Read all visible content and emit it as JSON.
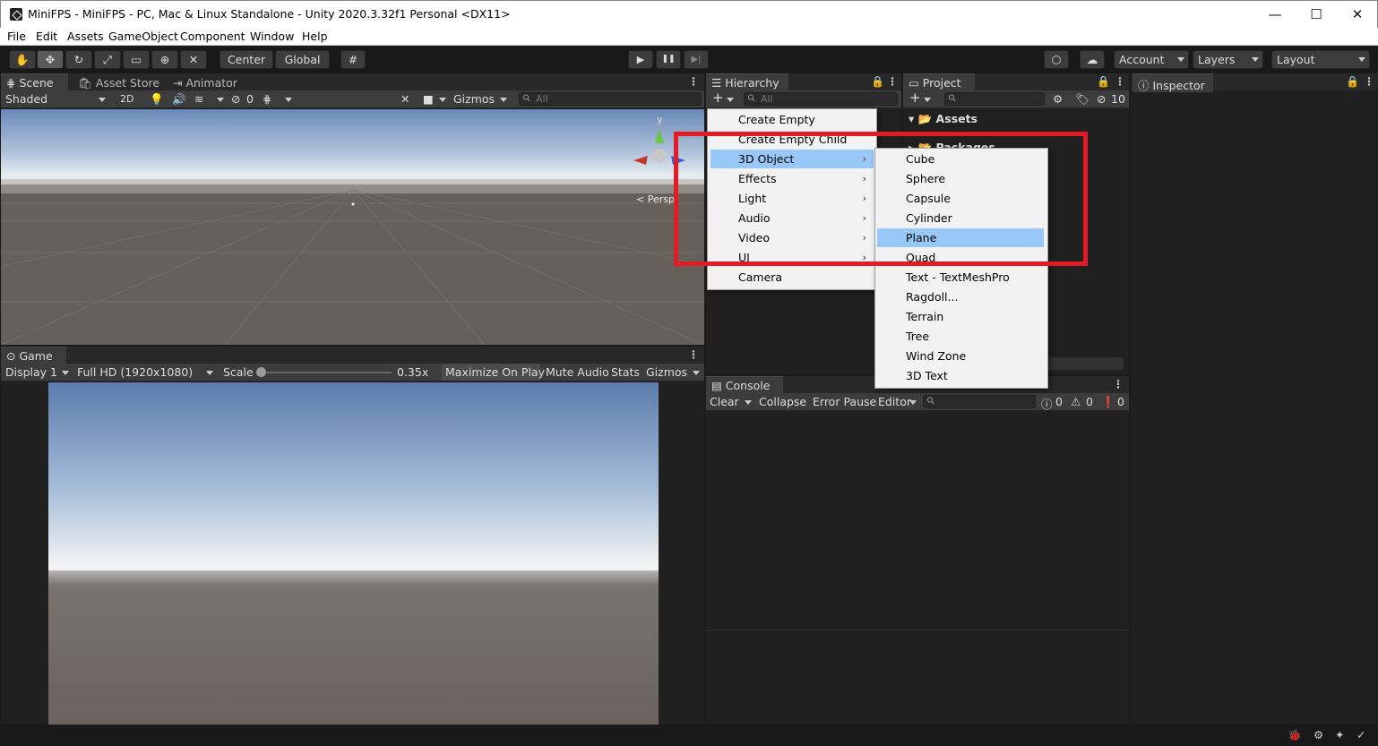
{
  "window": {
    "title": "MiniFPS - MiniFPS - PC, Mac & Linux Standalone - Unity 2020.3.32f1 Personal <DX11>",
    "minimize": "—",
    "maximize": "☐",
    "close": "✕"
  },
  "menubar": [
    "File",
    "Edit",
    "Assets",
    "GameObject",
    "Component",
    "Window",
    "Help"
  ],
  "toolbar": {
    "tools": [
      "hand-tool-icon",
      "move-tool-icon",
      "rotate-tool-icon",
      "scale-tool-icon",
      "rect-tool-icon",
      "transform-tool-icon",
      "custom-tool-icon"
    ],
    "pivot": "Center",
    "space": "Global",
    "play": "▶",
    "pause": "❚❚",
    "step": "▶|",
    "account": "Account",
    "layers": "Layers",
    "layout": "Layout"
  },
  "scene": {
    "tabs": [
      "Scene",
      "Asset Store",
      "Animator"
    ],
    "shading": "Shaded",
    "mode_2d": "2D",
    "hidden_count": "0",
    "gizmos": "Gizmos",
    "search_placeholder": "All",
    "gizmo_axis": "y",
    "gizmo_label": "< Persp"
  },
  "game": {
    "tab": "Game",
    "display": "Display 1",
    "resolution": "Full HD (1920x1080)",
    "scale_label": "Scale",
    "scale_value": "0.35x",
    "scale_fraction": 0.35,
    "maximize": "Maximize On Play",
    "mute": "Mute Audio",
    "stats": "Stats",
    "gizmos": "Gizmos"
  },
  "hierarchy": {
    "tab": "Hierarchy",
    "add": "+",
    "search_placeholder": "All"
  },
  "project": {
    "tab": "Project",
    "add": "+",
    "hidden_count": "10",
    "assets": "Assets",
    "packages": "Packages"
  },
  "inspector": {
    "tab": "Inspector"
  },
  "console": {
    "tab": "Console",
    "clear": "Clear",
    "collapse": "Collapse",
    "error_pause": "Error Pause",
    "editor": "Editor",
    "log_count": "0",
    "warn_count": "0",
    "error_count": "0"
  },
  "context_menu": {
    "items": [
      {
        "label": "Create Empty",
        "sub": false
      },
      {
        "label": "Create Empty Child",
        "sub": false
      },
      {
        "label": "3D Object",
        "sub": true
      },
      {
        "label": "Effects",
        "sub": true
      },
      {
        "label": "Light",
        "sub": true
      },
      {
        "label": "Audio",
        "sub": true
      },
      {
        "label": "Video",
        "sub": true
      },
      {
        "label": "UI",
        "sub": true
      },
      {
        "label": "Camera",
        "sub": false
      }
    ],
    "highlighted": "3D Object"
  },
  "submenu": {
    "items": [
      "Cube",
      "Sphere",
      "Capsule",
      "Cylinder",
      "Plane",
      "Quad",
      "Text - TextMeshPro",
      "Ragdoll...",
      "Terrain",
      "Tree",
      "Wind Zone",
      "3D Text"
    ],
    "highlighted": "Plane"
  },
  "colors": {
    "highlight": "#97c8f7",
    "annotation_box": "#e31b24",
    "panel_bg": "#202020"
  }
}
